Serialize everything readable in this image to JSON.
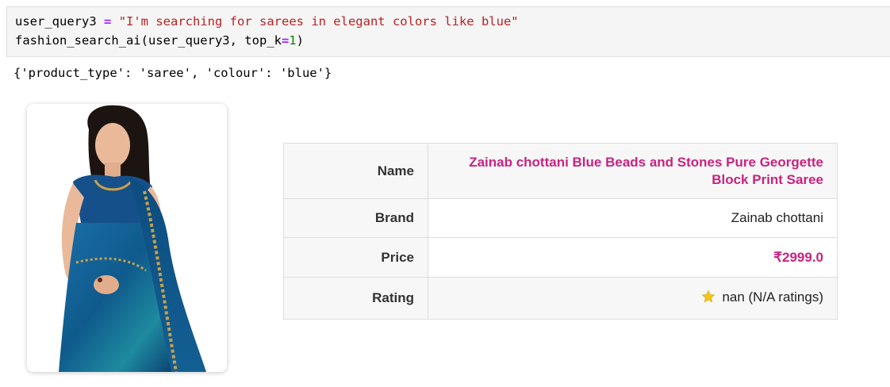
{
  "code_cell": {
    "line1": {
      "var": "user_query3",
      "op": "=",
      "string": "\"I'm searching for sarees in elegant colors like blue\""
    },
    "line2": {
      "func_call": "fashion_search_ai(user_query3, top_k",
      "op": "=",
      "num": "1",
      "close": ")"
    }
  },
  "output": {
    "parsed_query": "{'product_type': 'saree', 'colour': 'blue'}"
  },
  "product": {
    "image_icon": "saree-product-photo",
    "fields": {
      "name_label": "Name",
      "name_value_line1": "Zainab chottani Blue Beads and Stones Pure Georgette",
      "name_value_line2": "Block Print Saree",
      "brand_label": "Brand",
      "brand_value": "Zainab chottani",
      "price_label": "Price",
      "price_value": "₹2999.0",
      "rating_label": "Rating",
      "rating_icon": "star-icon",
      "rating_value": "nan (N/A ratings)"
    }
  },
  "colors": {
    "accent_pink": "#c8237f",
    "string_red": "#ba2121",
    "operator_purple": "#aa22ff",
    "number_green": "#008800",
    "star_gold": "#f5c518"
  }
}
